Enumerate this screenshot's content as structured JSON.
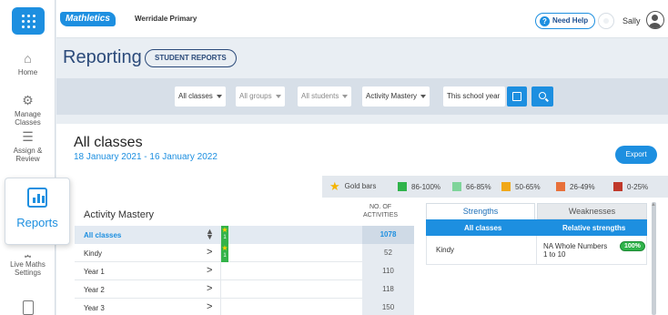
{
  "sidebar": {
    "items": [
      {
        "label": "Home",
        "icon": "home-icon"
      },
      {
        "label": "Manage Classes",
        "icon": "people-gear-icon"
      },
      {
        "label": "Assign & Review",
        "icon": "assign-icon"
      },
      {
        "label": "Reports",
        "icon": "chart-icon",
        "active": true
      },
      {
        "label": "Live Maths Settings",
        "icon": "settings-icon"
      },
      {
        "label": "",
        "icon": "document-icon"
      }
    ]
  },
  "topbar": {
    "logo": "Mathletics",
    "school": "Werridale Primary",
    "help": "Need Help",
    "user": "Sally"
  },
  "header": {
    "title": "Reporting",
    "student_reports": "STUDENT REPORTS"
  },
  "filters": {
    "classes": "All classes",
    "groups": "All groups",
    "students": "All students",
    "mastery": "Activity Mastery",
    "period": "This school year"
  },
  "panel": {
    "title": "All classes",
    "date_range": "18 January 2021 - 16 January 2022",
    "export": "Export"
  },
  "legend": [
    {
      "label": "Gold bars",
      "color": "#f4b400",
      "kind": "star"
    },
    {
      "label": "86-100%",
      "color": "#2fb34a"
    },
    {
      "label": "66-85%",
      "color": "#7fd49a"
    },
    {
      "label": "50-65%",
      "color": "#f0a818"
    },
    {
      "label": "26-49%",
      "color": "#e8703a"
    },
    {
      "label": "0-25%",
      "color": "#c0392b"
    }
  ],
  "table": {
    "title": "Activity Mastery",
    "col_activities": "NO. OF ACTIVITIES",
    "rows": [
      {
        "name": "All classes",
        "gold": "1",
        "activities": "1078"
      },
      {
        "name": "Kindy",
        "gold": "1",
        "activities": "52"
      },
      {
        "name": "Year 1",
        "gold": "",
        "activities": "110"
      },
      {
        "name": "Year 2",
        "gold": "",
        "activities": "118"
      },
      {
        "name": "Year 3",
        "gold": "",
        "activities": "150"
      }
    ]
  },
  "strengths": {
    "tab_strengths": "Strengths",
    "tab_weaknesses": "Weaknesses",
    "col_all": "All classes",
    "col_relative": "Relative strengths",
    "row_class": "Kindy",
    "row_topic_line1": "NA Whole Numbers",
    "row_topic_line2": "1 to 10",
    "row_pct": "100%"
  }
}
